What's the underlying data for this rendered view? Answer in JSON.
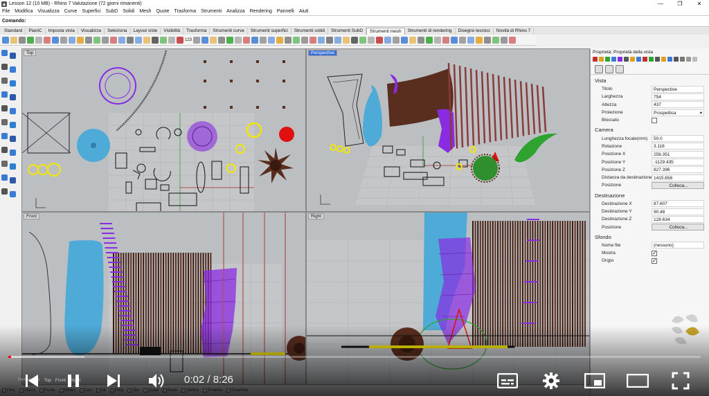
{
  "window": {
    "title": "Lesson 12 (10 MB) - Rhino 7 Valutazione (72 giorni rimanenti)",
    "controls": [
      "—",
      "❐",
      "✕"
    ]
  },
  "menu": [
    "File",
    "Modifica",
    "Visualizza",
    "Curve",
    "Superfici",
    "SubD",
    "Solidi",
    "Mesh",
    "Quote",
    "Trasforma",
    "Strumenti",
    "Analizza",
    "Rendering",
    "Pannelli",
    "Aiuti"
  ],
  "command": {
    "label": "Comando:",
    "value": ""
  },
  "toolbar_tabs": {
    "items": [
      "Standard",
      "PianiC",
      "Imposta vista",
      "Visualizza",
      "Seleziona",
      "Layout viste",
      "Visibilità",
      "Trasforma",
      "Strumenti curve",
      "Strumenti superfici",
      "Strumenti solidi",
      "Strumenti SubD",
      "Strumenti mesh",
      "Strumenti di rendering",
      "Disegno tecnico",
      "Novità di Rhino 7"
    ],
    "active_index": 12
  },
  "toolbar_mesh_label": "123",
  "viewports": {
    "top": {
      "label": "Top"
    },
    "perspective": {
      "label": "Perspective"
    },
    "front": {
      "label": "Front"
    },
    "right": {
      "label": "Right"
    }
  },
  "viewport_tabs": [
    "Perspective",
    "Top",
    "Front",
    "Right"
  ],
  "colors": {
    "viewport_bg": "#bcbfc2",
    "grid_minor": "#a9acae",
    "axis_x": "#b03030",
    "axis_y": "#3a9a3a",
    "purple": "#8a2be2",
    "blue_vase": "#4eaad6",
    "brown": "#5a2e1e",
    "yellow": "#f2e600",
    "green": "#2fa32f",
    "red": "#e01010",
    "yt_red": "#ff0000",
    "active_tab": "#3a6fd8"
  },
  "properties": {
    "title": "Proprietà: Proprietà della vista",
    "sections": {
      "vista": {
        "label": "Vista",
        "rows": [
          {
            "key": "Titolo",
            "value": "Perspective"
          },
          {
            "key": "Larghezza",
            "value": "754"
          },
          {
            "key": "Altezza",
            "value": "437"
          },
          {
            "key": "Proiezione",
            "value": "Prospettica"
          },
          {
            "key": "Bloccato",
            "value": ""
          }
        ]
      },
      "camera": {
        "label": "Camera",
        "rows": [
          {
            "key": "Lunghezza focale(mm)",
            "value": "50.0"
          },
          {
            "key": "Rotazione",
            "value": "3.118"
          },
          {
            "key": "Posizione X",
            "value": "256.351"
          },
          {
            "key": "Posizione Y",
            "value": "-1129.435"
          },
          {
            "key": "Posizione Z",
            "value": "827.396"
          },
          {
            "key": "Distanza da destinazione",
            "value": "1415.658"
          },
          {
            "key": "Posizione",
            "value": "Colloca..."
          }
        ]
      },
      "destinazione": {
        "label": "Destinazione",
        "rows": [
          {
            "key": "Destinazione X",
            "value": "87.607"
          },
          {
            "key": "Destinazione Y",
            "value": "90.48"
          },
          {
            "key": "Destinazione Z",
            "value": "128.634"
          },
          {
            "key": "Posizione",
            "value": "Colloca..."
          }
        ]
      },
      "sfondo": {
        "label": "Sfondo",
        "rows": [
          {
            "key": "Nome file",
            "value": "(nessuno)"
          },
          {
            "key": "Mostra",
            "value": ""
          },
          {
            "key": "Grigio",
            "value": ""
          }
        ]
      }
    }
  },
  "osnap": [
    "Fine",
    "Vicino",
    "Punto",
    "Medio",
    "Cen",
    "Int",
    "Perp",
    "Tan",
    "Quad",
    "Nodo",
    "Vertice",
    "Proietta",
    "Disabilita"
  ],
  "video": {
    "current": "0:02",
    "duration": "8:26",
    "time_display": "0:02 / 8:26",
    "played_fraction": 0.004,
    "buffered_fraction": 0.11
  }
}
